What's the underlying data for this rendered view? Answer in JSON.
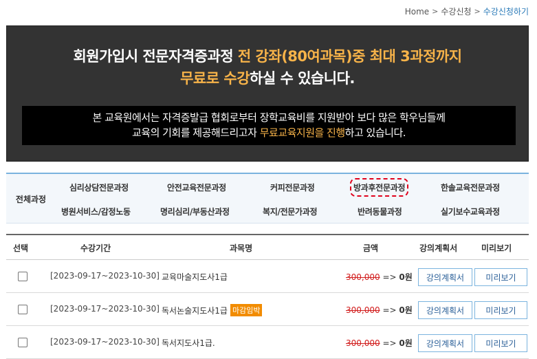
{
  "breadcrumb": {
    "home": "Home",
    "level1": "수강신청",
    "current": "수강신청하기",
    "sep": ">"
  },
  "banner": {
    "line1_a": "회원가입시 전문자격증과정 ",
    "line1_b": "전 강좌(80여과목)중 최대 3과정까지",
    "line2_a": "무료로 수강",
    "line2_b": "하실 수 있습니다.",
    "notice1": "본 교육원에서는 자격증발급 협회로부터 장학교육비를 지원받아 보다 많은 학우님들께",
    "notice2_a": "교육의 기회를 제공해드리고자 ",
    "notice2_b": "무료교육지원을 진행",
    "notice2_c": "하고 있습니다."
  },
  "categories": {
    "all": "전체과정",
    "items": [
      "심리상담전문과정",
      "안전교육전문과정",
      "커피전문과정",
      "방과후전문과정",
      "한솔교육전문과정",
      "병원서비스/감정노동",
      "명리심리/부동산과정",
      "복지/전문가과정",
      "반려동물과정",
      "실기보수교육과정"
    ]
  },
  "table": {
    "headers": [
      "선택",
      "수강기간",
      "과목명",
      "금액",
      "강의계획서",
      "미리보기"
    ],
    "rows": [
      {
        "period": "[2023-09-17~2023-10-30]",
        "title": "교육마술지도사1급",
        "badge": "",
        "orig": "300,000",
        "arrow": "=>",
        "final": "0원",
        "plan": "강의계획서",
        "preview": "미리보기"
      },
      {
        "period": "[2023-09-17~2023-10-30]",
        "title": "독서논술지도사1급",
        "badge": "마감임박",
        "orig": "300,000",
        "arrow": "=>",
        "final": "0원",
        "plan": "강의계획서",
        "preview": "미리보기"
      },
      {
        "period": "[2023-09-17~2023-10-30]",
        "title": "독서지도사1급.",
        "badge": "",
        "orig": "300,000",
        "arrow": "=>",
        "final": "0원",
        "plan": "강의계획서",
        "preview": "미리보기"
      }
    ]
  }
}
